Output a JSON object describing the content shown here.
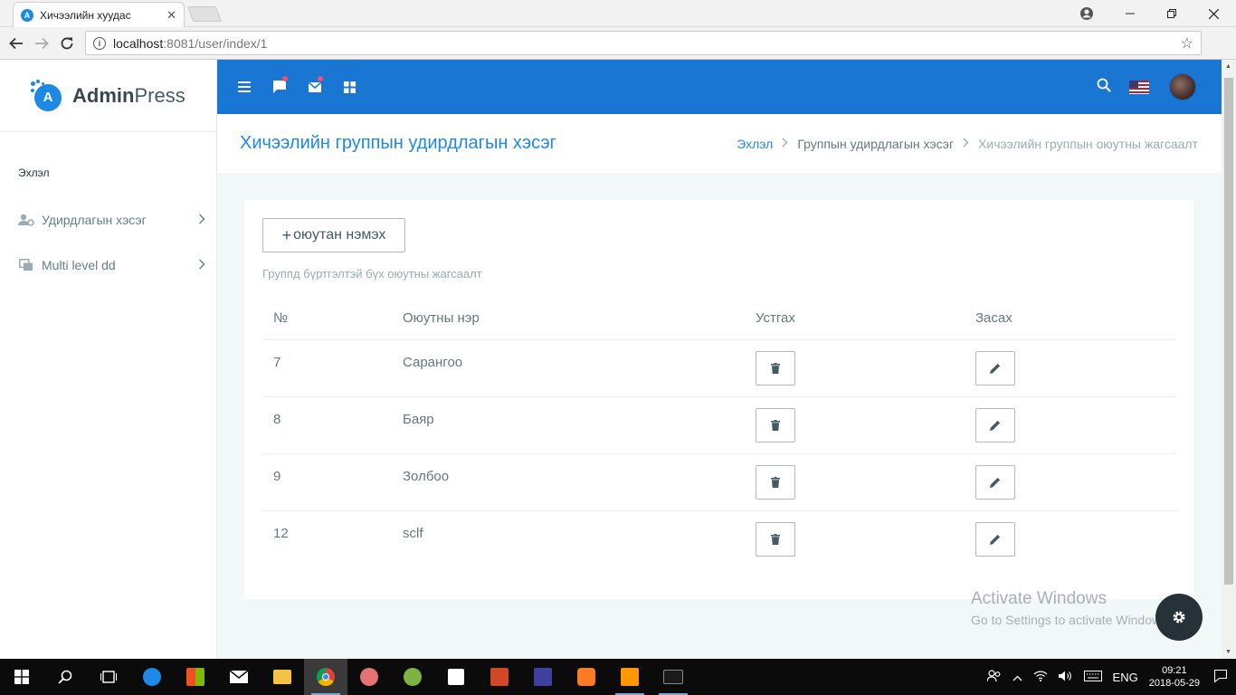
{
  "browser": {
    "tab_title": "Хичээлийн хуудас",
    "tab_close": "✕",
    "url_host": "localhost",
    "url_rest": ":8081/user/index/1"
  },
  "app": {
    "brand_bold": "Admin",
    "brand_light": "Press",
    "logo_letter": "A"
  },
  "sidebar": {
    "heading": "Эхлэл",
    "items": [
      {
        "label": "Удирдлагын хэсэг",
        "icon": "user-gear-icon"
      },
      {
        "label": "Multi level dd",
        "icon": "layers-icon"
      }
    ]
  },
  "page": {
    "title": "Хичээлийн группын удирдлагын хэсэг",
    "breadcrumbs": [
      "Эхлэл",
      "Группын удирдлагын хэсэг",
      "Хичээлийн группын оюутны жагсаалт"
    ]
  },
  "card": {
    "add_button": "оюутан нэмэх",
    "add_plus": "+",
    "subtitle": "Группд бүртгэлтэй бүх оюутны жагсаалт",
    "columns": [
      "№",
      "Оюутны нэр",
      "Устгах",
      "Засах"
    ],
    "rows": [
      {
        "no": "7",
        "name": "Сарангоо"
      },
      {
        "no": "8",
        "name": "Баяр"
      },
      {
        "no": "9",
        "name": "Золбоо"
      },
      {
        "no": "12",
        "name": "sclf"
      }
    ]
  },
  "watermark": {
    "line1": "Activate Windows",
    "line2": "Go to Settings to activate Windows."
  },
  "taskbar": {
    "lang": "ENG",
    "time": "09:21",
    "date": "2018-05-29"
  },
  "colors": {
    "primary": "#1e88e5",
    "topbar": "#1976d2",
    "content_bg": "#f2f7f8",
    "badge": "#fc4b6c"
  }
}
